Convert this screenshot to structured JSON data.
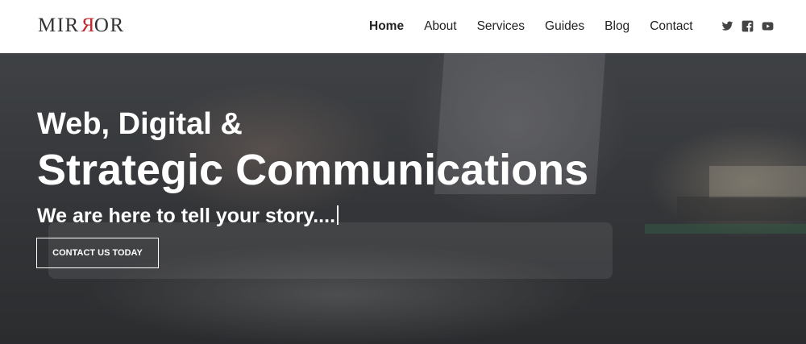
{
  "brand": {
    "logo_start": "MIR",
    "logo_mid": "R",
    "logo_end": "OR",
    "accent": "#c0272d"
  },
  "nav": {
    "items": [
      {
        "label": "Home",
        "active": true
      },
      {
        "label": "About"
      },
      {
        "label": "Services"
      },
      {
        "label": "Guides"
      },
      {
        "label": "Blog"
      },
      {
        "label": "Contact"
      }
    ]
  },
  "social": [
    {
      "icon": "twitter-icon"
    },
    {
      "icon": "facebook-icon"
    },
    {
      "icon": "youtube-icon"
    }
  ],
  "hero": {
    "heading_line1": "Web, Digital &",
    "heading_line2": "Strategic Communications",
    "tagline": "We are here to tell your story....",
    "cta_label": "CONTACT US TODAY"
  }
}
